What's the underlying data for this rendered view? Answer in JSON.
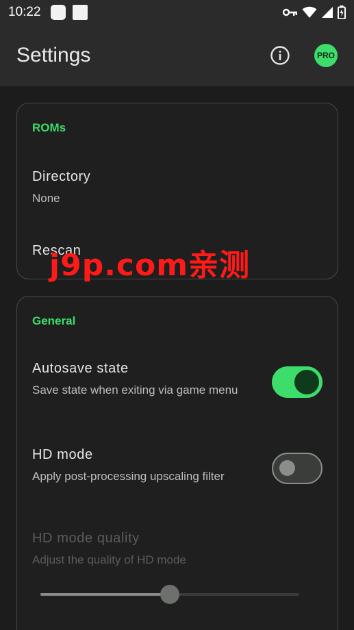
{
  "status_bar": {
    "time": "10:22",
    "icons": [
      "notification-icon",
      "notification-icon",
      "vpn-key-icon",
      "wifi-icon",
      "signal-icon",
      "battery-icon"
    ]
  },
  "app_bar": {
    "title": "Settings",
    "info_icon": "info-icon",
    "pro_label": "PRO"
  },
  "sections": {
    "roms": {
      "title": "ROMs",
      "directory_title": "Directory",
      "directory_value": "None",
      "rescan_title": "Rescan"
    },
    "general": {
      "title": "General",
      "autosave_title": "Autosave state",
      "autosave_summary": "Save state when exiting via game menu",
      "autosave_enabled": true,
      "hd_title": "HD mode",
      "hd_summary": "Apply post-processing upscaling filter",
      "hd_enabled": false,
      "hd_quality_title": "HD mode quality",
      "hd_quality_summary": "Adjust the quality of HD mode",
      "hd_quality_value": 0.5
    }
  },
  "watermark": "j9p.com亲测",
  "colors": {
    "accent": "#3ddc6b",
    "background": "#1b1c1b",
    "app_bar": "#2a2b2a",
    "watermark": "#ff1a1a"
  }
}
